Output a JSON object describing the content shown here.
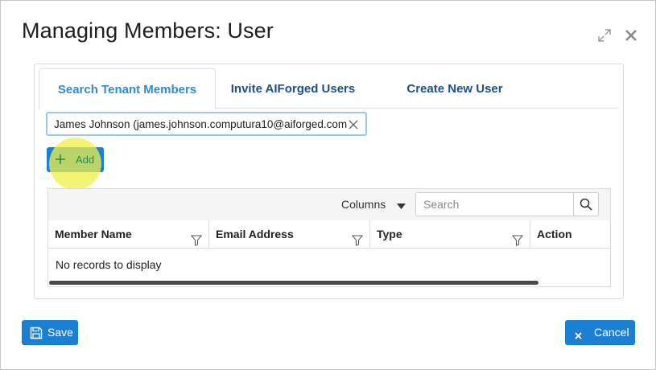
{
  "dialog": {
    "title": "Managing Members: User"
  },
  "tabs": [
    {
      "label": "Search Tenant Members",
      "active": true
    },
    {
      "label": "Invite AIForged Users",
      "active": false
    },
    {
      "label": "Create New User",
      "active": false
    }
  ],
  "member_field": {
    "value": "James Johnson (james.johnson.computura10@aiforged.com)"
  },
  "add_button": {
    "label": "Add"
  },
  "grid": {
    "columns_label": "Columns",
    "search_placeholder": "Search",
    "headers": [
      "Member Name",
      "Email Address",
      "Type",
      "Action"
    ],
    "empty_message": "No records to display"
  },
  "footer": {
    "save_label": "Save",
    "cancel_label": "Cancel"
  },
  "colors": {
    "accent": "#1b7fd2",
    "active_tab": "#2f8ad6",
    "tab_text": "#1f4f8a",
    "highlight": "#f0f046"
  },
  "icons": {
    "expand": "expand-icon",
    "close": "close-icon",
    "clear": "clear-icon",
    "plus": "plus-icon",
    "caret": "caret-down-icon",
    "search": "search-icon",
    "filter": "filter-icon",
    "save": "floppy-disk-icon",
    "cancel": "x-icon"
  }
}
